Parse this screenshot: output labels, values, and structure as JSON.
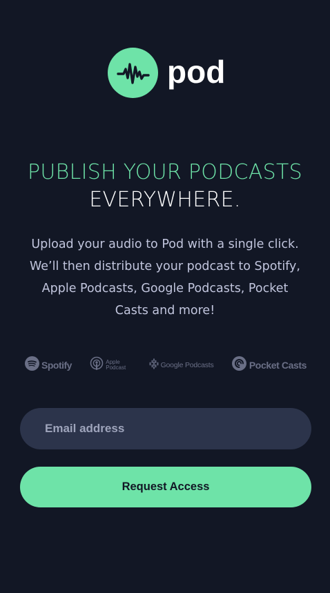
{
  "brand": {
    "name": "pod",
    "logo_icon": "audio-wave-icon",
    "accent_color": "#6ee3a8",
    "background_color": "#121725"
  },
  "headline": {
    "line1": "PUBLISH YOUR PODCASTS",
    "line2": "EVERYWHERE."
  },
  "description": "Upload your audio to Pod with a single click. We’ll then distribute your podcast to Spotify, Apple Podcasts, Google Podcasts, Pocket Casts and more!",
  "platforms": [
    {
      "name": "Spotify",
      "icon": "spotify-icon"
    },
    {
      "name": "Apple Podcast",
      "icon": "apple-podcasts-icon"
    },
    {
      "name": "Google Podcasts",
      "icon": "google-podcasts-icon"
    },
    {
      "name": "Pocket Casts",
      "icon": "pocket-casts-icon"
    }
  ],
  "form": {
    "email_placeholder": "Email address",
    "email_value": "",
    "submit_label": "Request Access"
  }
}
